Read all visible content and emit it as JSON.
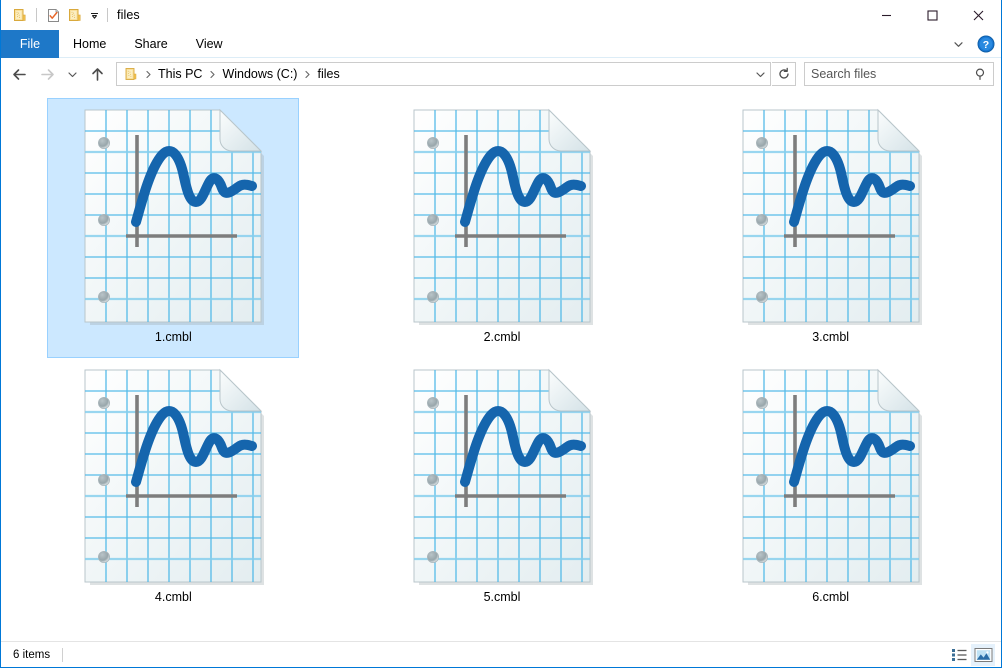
{
  "window": {
    "title": "files",
    "quick_access": [
      {
        "name": "properties-icon",
        "label": "Properties"
      },
      {
        "name": "new-folder-check-icon",
        "label": "New folder"
      },
      {
        "name": "folder-icon",
        "label": "Folder"
      }
    ],
    "controls": {
      "minimize": "─",
      "maximize": "□",
      "close": "✕"
    }
  },
  "ribbon": {
    "tabs": [
      {
        "label": "File",
        "active": true
      },
      {
        "label": "Home",
        "active": false
      },
      {
        "label": "Share",
        "active": false
      },
      {
        "label": "View",
        "active": false
      }
    ],
    "collapse_label": "Minimize the Ribbon",
    "help_label": "?"
  },
  "address": {
    "back_label": "Back",
    "forward_label": "Forward",
    "recent_label": "Recent locations",
    "up_label": "Up",
    "breadcrumbs": [
      {
        "label": "This PC"
      },
      {
        "label": "Windows (C:)"
      },
      {
        "label": "files"
      }
    ],
    "dropdown_label": "Previous locations",
    "refresh_label": "Refresh"
  },
  "search": {
    "placeholder": "Search files",
    "value": "",
    "icon": "search-icon"
  },
  "files": [
    {
      "name": "1.cmbl",
      "selected": true
    },
    {
      "name": "2.cmbl",
      "selected": false
    },
    {
      "name": "3.cmbl",
      "selected": false
    },
    {
      "name": "4.cmbl",
      "selected": false
    },
    {
      "name": "5.cmbl",
      "selected": false
    },
    {
      "name": "6.cmbl",
      "selected": false
    }
  ],
  "status": {
    "item_count": "6 items",
    "views": [
      {
        "name": "details-view-button",
        "active": false
      },
      {
        "name": "large-icons-view-button",
        "active": true
      }
    ]
  },
  "colors": {
    "accent": "#0078d7",
    "file_tab": "#1e78c8",
    "selection_fill": "#cce8ff",
    "selection_border": "#99d1ff",
    "icon_curve": "#1565ad",
    "icon_grid": "#4db8e8",
    "icon_axis": "#7d7d7d",
    "folder_icon": "#f7d17c"
  }
}
